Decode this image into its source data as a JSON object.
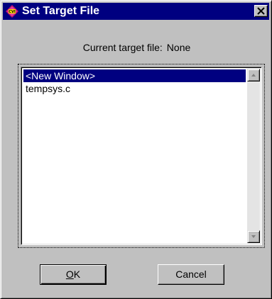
{
  "window": {
    "title": "Set Target File",
    "app_icon": "cvi-app-icon",
    "close_icon": "close-icon"
  },
  "target": {
    "label": "Current target file:",
    "value": "None"
  },
  "files": {
    "items": [
      {
        "label": "<New Window>",
        "selected": true
      },
      {
        "label": "tempsys.c",
        "selected": false
      }
    ]
  },
  "buttons": {
    "ok_mnemonic": "O",
    "ok_rest": "K",
    "cancel": "Cancel"
  },
  "colors": {
    "titlebar": "#000080",
    "face": "#c0c0c0",
    "selection": "#000080",
    "icon": "#c01070"
  }
}
